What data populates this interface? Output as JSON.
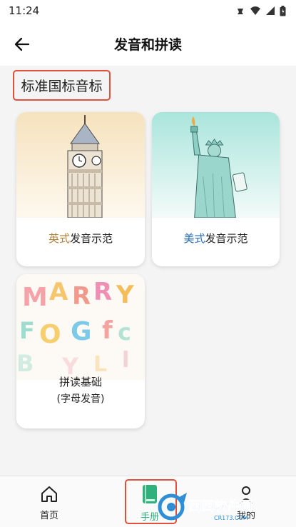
{
  "status_bar": {
    "time": "11:24"
  },
  "app_bar": {
    "title": "发音和拼读"
  },
  "section": {
    "title": "标准国标音标"
  },
  "cards": [
    {
      "accent": "英式",
      "rest": "发音示范",
      "accent_color": "#b08138"
    },
    {
      "accent": "美式",
      "rest": "发音示范",
      "accent_color": "#2a6fb7"
    },
    {
      "line1": "拼读基础",
      "line2": "(字母发音)"
    }
  ],
  "bottom_nav": {
    "items": [
      {
        "label": "首页"
      },
      {
        "label": "手册",
        "active": true
      },
      {
        "label": "我的"
      }
    ],
    "active_color": "#2fb07d"
  },
  "watermark": {
    "text": "西西软件园",
    "sub": "CR173.COM"
  },
  "colors": {
    "highlight_box": "#e0503a"
  }
}
